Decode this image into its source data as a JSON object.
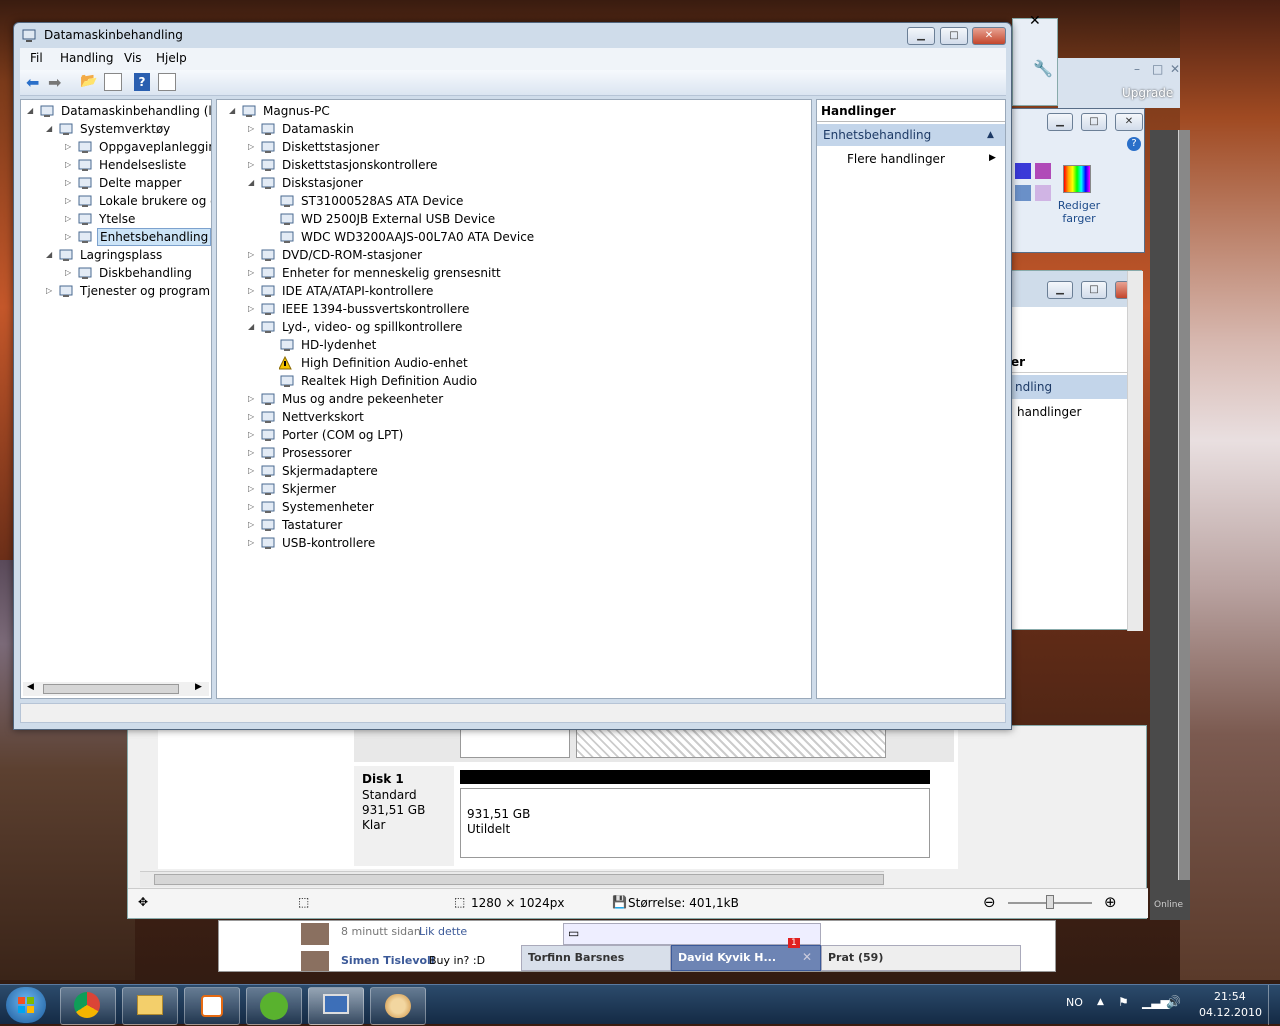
{
  "main_window": {
    "title": "Datamaskinbehandling",
    "menu": [
      "Fil",
      "Handling",
      "Vis",
      "Hjelp"
    ],
    "left_tree": [
      {
        "label": "Datamaskinbehandling (lokal)",
        "level": 0
      },
      {
        "label": "Systemverktøy",
        "level": 1
      },
      {
        "label": "Oppgaveplanlegging",
        "level": 2
      },
      {
        "label": "Hendelsesliste",
        "level": 2
      },
      {
        "label": "Delte mapper",
        "level": 2
      },
      {
        "label": "Lokale brukere og grupp",
        "level": 2
      },
      {
        "label": "Ytelse",
        "level": 2
      },
      {
        "label": "Enhetsbehandling",
        "level": 2
      },
      {
        "label": "Lagringsplass",
        "level": 1
      },
      {
        "label": "Diskbehandling",
        "level": 2
      },
      {
        "label": "Tjenester og programmer",
        "level": 1
      }
    ],
    "device_tree": [
      {
        "label": "Magnus-PC",
        "level": 0
      },
      {
        "label": "Datamaskin",
        "level": 1
      },
      {
        "label": "Diskettstasjoner",
        "level": 1
      },
      {
        "label": "Diskettstasjonskontrollere",
        "level": 1
      },
      {
        "label": "Diskstasjoner",
        "level": 1
      },
      {
        "label": "ST31000528AS ATA Device",
        "level": 2
      },
      {
        "label": "WD 2500JB External USB Device",
        "level": 2
      },
      {
        "label": "WDC WD3200AAJS-00L7A0 ATA Device",
        "level": 2
      },
      {
        "label": "DVD/CD-ROM-stasjoner",
        "level": 1
      },
      {
        "label": "Enheter for menneskelig grensesnitt",
        "level": 1
      },
      {
        "label": "IDE ATA/ATAPI-kontrollere",
        "level": 1
      },
      {
        "label": "IEEE 1394-bussvertskontrollere",
        "level": 1
      },
      {
        "label": "Lyd-, video- og spillkontrollere",
        "level": 1
      },
      {
        "label": "HD-lydenhet",
        "level": 2
      },
      {
        "label": "High Definition Audio-enhet",
        "level": 2
      },
      {
        "label": "Realtek High Definition Audio",
        "level": 2
      },
      {
        "label": "Mus og andre pekeenheter",
        "level": 1
      },
      {
        "label": "Nettverkskort",
        "level": 1
      },
      {
        "label": "Porter (COM og LPT)",
        "level": 1
      },
      {
        "label": "Prosessorer",
        "level": 1
      },
      {
        "label": "Skjermadaptere",
        "level": 1
      },
      {
        "label": "Skjermer",
        "level": 1
      },
      {
        "label": "Systemenheter",
        "level": 1
      },
      {
        "label": "Tastaturer",
        "level": 1
      },
      {
        "label": "USB-kontrollere",
        "level": 1
      }
    ],
    "actions": {
      "header": "Handlinger",
      "section": "Enhetsbehandling",
      "more": "Flere handlinger"
    }
  },
  "paint_window": {
    "edit_colors": "Rediger\nfarger",
    "upgrade": "Upgrade"
  },
  "bg_actions": {
    "header_fragment": "er",
    "section_fragment": "ndling",
    "more_fragment": "handlinger"
  },
  "disk_window": {
    "disk_name": "Disk 1",
    "disk_type": "Standard",
    "disk_size": "931,51 GB",
    "disk_status": "Klar",
    "partition_size": "931,51 GB",
    "partition_status": "Utildelt",
    "image_size": "1280 × 1024px",
    "file_size": "Størrelse: 401,1kB"
  },
  "chat": {
    "time_ago": "8 minutt sidan",
    "like": "Lik dette",
    "sender": "Simen Tislevoll",
    "message": "Buy in? :D",
    "tab1": "Torfinn Barsnes",
    "tab2": "David Kyvik H...",
    "tab2_badge": "1",
    "chat_label": "Prat (59)"
  },
  "tray": {
    "lang": "NO",
    "time": "21:54",
    "date": "04.12.2010"
  },
  "bg_online": "Online",
  "colors": {
    "selection": "#cce4f7",
    "actions_header": "#c3d5ea",
    "title_bar": "#cfdcea"
  }
}
